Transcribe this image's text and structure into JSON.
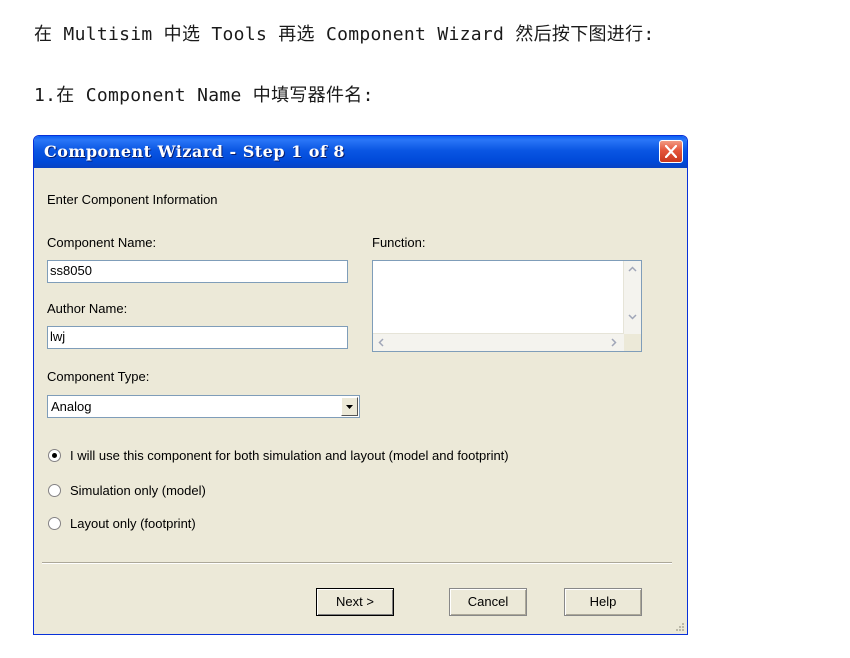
{
  "doc": {
    "line1": "在 Multisim 中选 Tools 再选 Component Wizard 然后按下图进行:",
    "line2": "1.在 Component Name 中填写器件名:"
  },
  "window": {
    "title": "Component Wizard - Step 1 of 8",
    "section_heading": "Enter Component Information",
    "component_name_label": "Component Name:",
    "component_name_value": "ss8050",
    "author_name_label": "Author Name:",
    "author_name_value": "lwj",
    "function_label": "Function:",
    "function_value": "",
    "component_type_label": "Component Type:",
    "component_type_value": "Analog",
    "radio_options": [
      {
        "label": "I will use this component for both simulation and layout (model and footprint)",
        "selected": true
      },
      {
        "label": "Simulation only (model)",
        "selected": false
      },
      {
        "label": "Layout only (footprint)",
        "selected": false
      }
    ],
    "buttons": {
      "next": "Next >",
      "cancel": "Cancel",
      "help": "Help"
    }
  },
  "colors": {
    "titlebar": "#0a56e3",
    "dialog_bg": "#ece9d8",
    "close_button": "#e4553b"
  },
  "icons": [
    "close-icon",
    "scroll-up-icon",
    "scroll-down-icon",
    "scroll-left-icon",
    "scroll-right-icon",
    "dropdown-arrow-icon",
    "resize-grip-icon"
  ]
}
